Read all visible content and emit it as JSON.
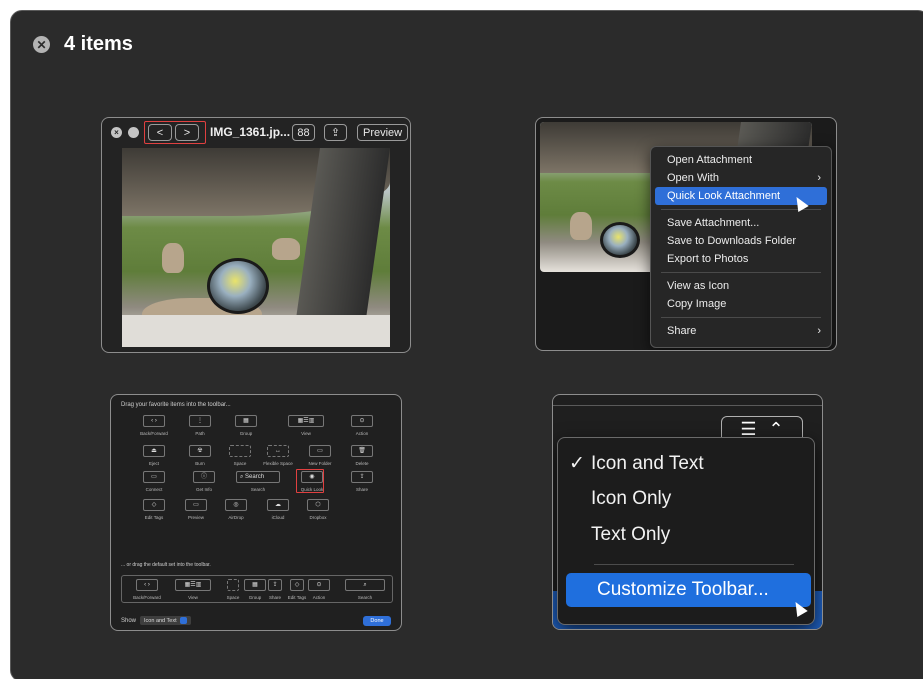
{
  "header": {
    "close_icon_glyph": "✕",
    "title": "4 items"
  },
  "card1": {
    "back_glyph": "<",
    "forward_glyph": ">",
    "filename": "IMG_1361.jp...",
    "grid_glyph": "88",
    "share_glyph": "⇪",
    "preview_label": "Preview"
  },
  "card2": {
    "menu_items": [
      "Open Attachment",
      "Open With",
      "Quick Look Attachment",
      "Save Attachment...",
      "Save to Downloads Folder",
      "Export to Photos",
      "View as Icon",
      "Copy Image",
      "Share"
    ],
    "selected_item": "Quick Look Attachment",
    "submenu_arrow": "›"
  },
  "card3": {
    "heading": "Drag your favorite items into the toolbar...",
    "tools": [
      "Back/Forward",
      "Path",
      "Group",
      "View",
      "Action",
      "Eject",
      "Burn",
      "Space",
      "Flexible Space",
      "New Folder",
      "Delete",
      "Connect",
      "Get Info",
      "Search",
      "Quick Look",
      "Share",
      "Edit Tags",
      "Preview",
      "AirDrop",
      "iCloud",
      "Dropbox"
    ],
    "search_placeholder": "Search",
    "default_set_label": "... or drag the default set into the toolbar.",
    "default_items": [
      "Back/Forward",
      "View",
      "Space",
      "Group",
      "Share",
      "Edit Tags",
      "Action",
      "Search"
    ],
    "show_label": "Show",
    "show_value": "Icon and Text",
    "done_label": "Done"
  },
  "card4": {
    "toolbar_button_glyph": "☰",
    "toolbar_chevron": "⌃",
    "checkmark": "✓",
    "options": [
      "Icon and Text",
      "Icon Only",
      "Text Only"
    ],
    "checked_option": "Icon and Text",
    "customize_label": "Customize Toolbar..."
  }
}
